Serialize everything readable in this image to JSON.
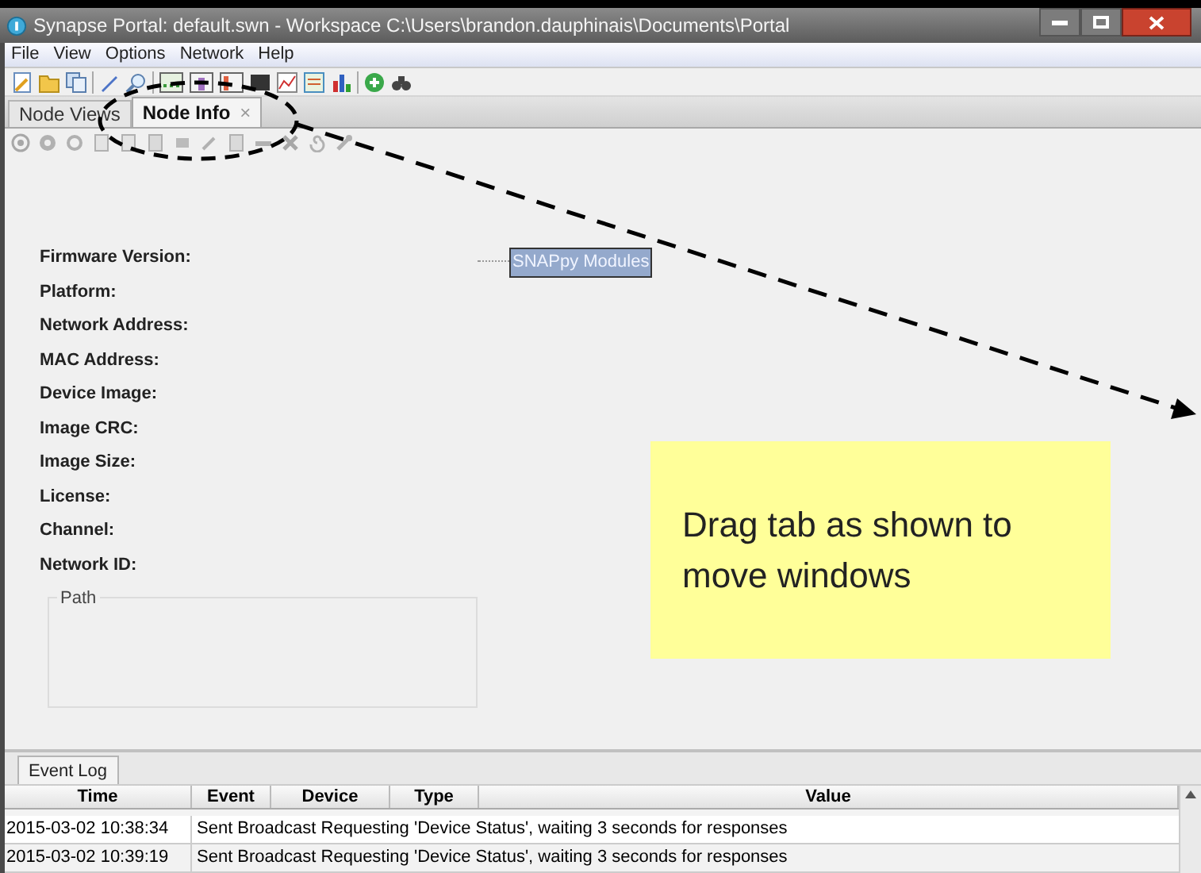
{
  "window": {
    "title": "Synapse Portal: default.swn - Workspace C:\\Users\\brandon.dauphinais\\Documents\\Portal"
  },
  "menu": [
    "File",
    "View",
    "Options",
    "Network",
    "Help"
  ],
  "tabs": [
    {
      "label": "Node Views",
      "selected": false
    },
    {
      "label": "Node Info",
      "selected": true,
      "close_glyph": "×"
    }
  ],
  "node_info": {
    "fields": [
      "Firmware Version:",
      "Platform:",
      "Network Address:",
      "MAC Address:",
      "Device Image:",
      "Image CRC:",
      "Image Size:",
      "License:",
      "Channel:",
      "Network ID:"
    ],
    "tree_node": "SNAPpy Modules",
    "path_group": "Path"
  },
  "note": {
    "text": "Drag tab as shown to move windows"
  },
  "event_log": {
    "tab": "Event Log",
    "columns": [
      "Time",
      "Event",
      "Device",
      "Type",
      "Value"
    ],
    "rows": [
      {
        "time": "2015-03-02 10:38:34",
        "message": "Sent Broadcast Requesting 'Device Status', waiting 3 seconds for responses"
      },
      {
        "time": "2015-03-02 10:39:19",
        "message": "Sent Broadcast Requesting 'Device Status', waiting 3 seconds for responses"
      }
    ]
  }
}
